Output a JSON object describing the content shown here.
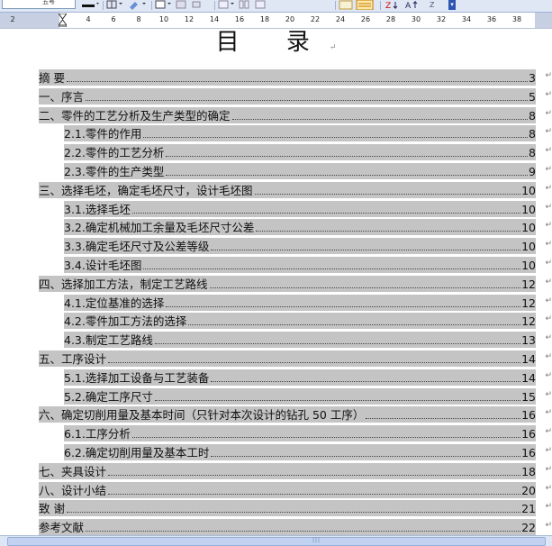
{
  "toolbar": {
    "font_size_value": "五号",
    "icons": [
      "font-color-icon",
      "border-icon",
      "highlight-icon",
      "table-icon",
      "columns-icon",
      "drawing-icon",
      "sort-ascending-icon",
      "sort-descending-icon",
      "sum-icon",
      "toolbar-options-icon"
    ]
  },
  "ruler": {
    "ticks": [
      "2",
      "4",
      "6",
      "8",
      "10",
      "12",
      "14",
      "16",
      "18",
      "20",
      "22",
      "24",
      "26",
      "28",
      "30",
      "32",
      "34",
      "36",
      "38"
    ]
  },
  "document": {
    "title": "目 录",
    "toc": [
      {
        "text": "摘    要",
        "page": "3",
        "level": 1
      },
      {
        "text": "一、序言",
        "page": "5",
        "level": 1
      },
      {
        "text": "二、零件的工艺分析及生产类型的确定",
        "page": "8",
        "level": 1
      },
      {
        "text": "2.1.零件的作用",
        "page": "8",
        "level": 2
      },
      {
        "text": "2.2.零件的工艺分析",
        "page": "8",
        "level": 2
      },
      {
        "text": "2.3.零件的生产类型",
        "page": "9",
        "level": 2
      },
      {
        "text": "三、选择毛坯，确定毛坯尺寸，设计毛坯图",
        "page": "10",
        "level": 1
      },
      {
        "text": "3.1.选择毛坯",
        "page": "10",
        "level": 2
      },
      {
        "text": "3.2.确定机械加工余量及毛坯尺寸公差",
        "page": "10",
        "level": 2
      },
      {
        "text": "3.3.确定毛坯尺寸及公差等级",
        "page": "10",
        "level": 2
      },
      {
        "text": "3.4.设计毛坯图",
        "page": "10",
        "level": 2
      },
      {
        "text": "四、选择加工方法，制定工艺路线",
        "page": "12",
        "level": 1
      },
      {
        "text": "4.1.定位基准的选择",
        "page": "12",
        "level": 2
      },
      {
        "text": "4.2.零件加工方法的选择",
        "page": "12",
        "level": 2
      },
      {
        "text": "4.3.制定工艺路线",
        "page": "13",
        "level": 2
      },
      {
        "text": "五、工序设计",
        "page": "14",
        "level": 1
      },
      {
        "text": "5.1.选择加工设备与工艺装备",
        "page": "14",
        "level": 2
      },
      {
        "text": "5.2.确定工序尺寸",
        "page": "15",
        "level": 2
      },
      {
        "text": "六、确定切削用量及基本时间（只针对本次设计的钻孔 50 工序）",
        "page": "16",
        "level": 1
      },
      {
        "text": "6.1.工序分析",
        "page": "16",
        "level": 2
      },
      {
        "text": "6.2.确定切削用量及基本工时",
        "page": "16",
        "level": 2
      },
      {
        "text": "七、夹具设计",
        "page": "18",
        "level": 1
      },
      {
        "text": "八、设计小结",
        "page": "20",
        "level": 1
      },
      {
        "text": "致    谢",
        "page": "21",
        "level": 1
      },
      {
        "text": "参考文献",
        "page": "22",
        "level": 1
      }
    ]
  },
  "colors": {
    "toc_shading": "#c4c4c4",
    "toolbar_bg": "#dfe7f5",
    "ruler_margin": "#c6d0e2"
  }
}
